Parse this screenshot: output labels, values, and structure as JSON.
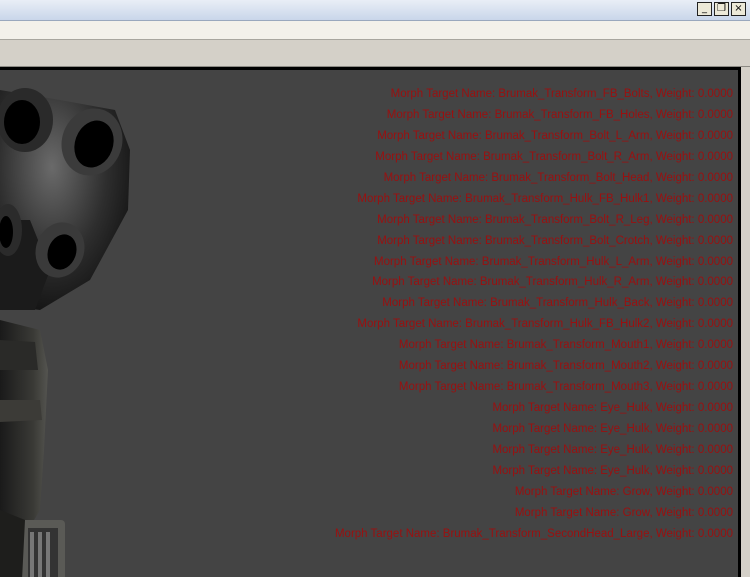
{
  "window": {
    "controls": [
      "_",
      "❐",
      "×"
    ]
  },
  "viewport": {
    "background": "#444444",
    "text_color": "#9a1010",
    "morph_lines": [
      "Morph Target Name: Brumak_Transform_FB_Bolts, Weight: 0.0000",
      "Morph Target Name: Brumak_Transform_FB_Holes, Weight: 0.0000",
      "Morph Target Name: Brumak_Transform_Bolt_L_Arm, Weight: 0.0000",
      "Morph Target Name: Brumak_Transform_Bolt_R_Arm, Weight: 0.0000",
      "Morph Target Name: Brumak_Transform_Bolt_Head, Weight: 0.0000",
      "Morph Target Name: Brumak_Transform_Hulk_FB_Hulk1, Weight: 0.0000",
      "Morph Target Name: Brumak_Transform_Bolt_R_Leg, Weight: 0.0000",
      "Morph Target Name: Brumak_Transform_Bolt_Crotch, Weight: 0.0000",
      "Morph Target Name: Brumak_Transform_Hulk_L_Arm, Weight: 0.0000",
      "Morph Target Name: Brumak_Transform_Hulk_R_Arm, Weight: 0.0000",
      "Morph Target Name: Brumak_Transform_Hulk_Back, Weight: 0.0000",
      "Morph Target Name: Brumak_Transform_Hulk_FB_Hulk2, Weight: 0.0000",
      "Morph Target Name: Brumak_Transform_Mouth1, Weight: 0.0000",
      "Morph Target Name: Brumak_Transform_Mouth2, Weight: 0.0000",
      "Morph Target Name: Brumak_Transform_Mouth3, Weight: 0.0000",
      "Morph Target Name: Eye_Hulk, Weight: 0.0000",
      "Morph Target Name: Eye_Hulk, Weight: 0.0000",
      "Morph Target Name: Eye_Hulk, Weight: 0.0000",
      "Morph Target Name: Eye_Hulk, Weight: 0.0000",
      "Morph Target Name: Grow, Weight: 0.0000",
      "Morph Target Name: Grow, Weight: 0.0000",
      "Morph Target Name: Brumak_Transform_SecondHead_Large, Weight: 0.0000"
    ]
  }
}
